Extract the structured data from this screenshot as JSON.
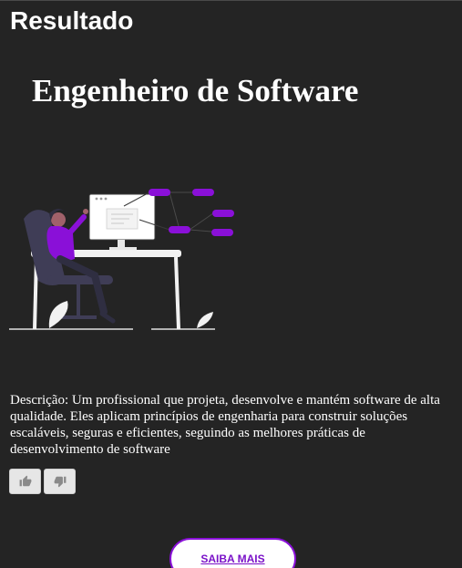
{
  "page": {
    "heading": "Resultado"
  },
  "result": {
    "title": "Engenheiro de Software",
    "description": "Descrição: Um profissional que projeta, desenvolve e mantém software de alta qualidade. Eles aplicam princípios de engenharia para construir soluções escaláveis, seguras e eficientes, seguindo as melhores práticas de desenvolvimento de software"
  },
  "feedback": {
    "like_icon": "thumbs-up-icon",
    "dislike_icon": "thumbs-down-icon"
  },
  "cta": {
    "label": "SAIBA MAIS"
  },
  "colors": {
    "background": "#242424",
    "accent": "#8a10d8",
    "text": "#ffffff",
    "button_bg": "#e6e6e6"
  }
}
